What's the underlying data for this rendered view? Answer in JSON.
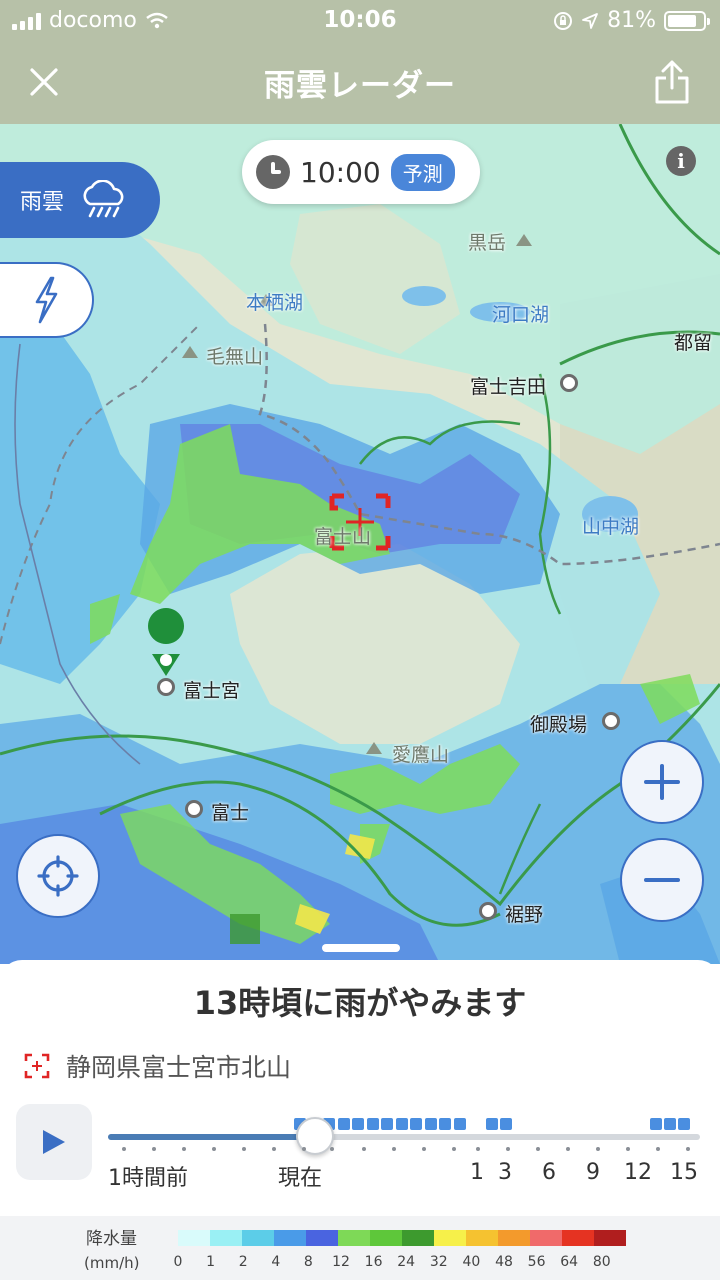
{
  "status_bar": {
    "carrier": "docomo",
    "time": "10:06",
    "battery": "81%",
    "battery_level": 0.81
  },
  "nav": {
    "title": "雨雲レーダー"
  },
  "map": {
    "time": "10:00",
    "time_badge": "予測",
    "layer_rain_label": "雨雲",
    "labels": {
      "kurodake": "黒岳",
      "motosuko": "本栖湖",
      "kawaguchiko": "河口湖",
      "tsuru": "都留",
      "kenashiyama": "毛無山",
      "fujiyoshida": "富士吉田",
      "fujisan": "富士山",
      "yamanakako": "山中湖",
      "fujinomiya": "富士宮",
      "gotemba": "御殿場",
      "ashitakayama": "愛鷹山",
      "fuji": "富士",
      "susono": "裾野"
    }
  },
  "sheet": {
    "headline": "13時頃に雨がやみます",
    "location": "静岡県富士宮市北山",
    "progress": 0.35,
    "ticks": [
      "1時間前",
      "現在",
      "1",
      "3",
      "6",
      "9",
      "12",
      "15"
    ]
  },
  "legend": {
    "title": "降水量",
    "unit": "(mm/h)",
    "values": [
      "0",
      "1",
      "2",
      "4",
      "8",
      "12",
      "16",
      "24",
      "32",
      "40",
      "48",
      "56",
      "64",
      "80"
    ],
    "colors": [
      "#d9fbfb",
      "#9af0f4",
      "#5ccde8",
      "#4a9be8",
      "#4a64e0",
      "#7ed957",
      "#5ec73a",
      "#3d9a2e",
      "#f6f04a",
      "#f5c230",
      "#f39a2c",
      "#f06a6a",
      "#e53322",
      "#b01e1e"
    ]
  }
}
